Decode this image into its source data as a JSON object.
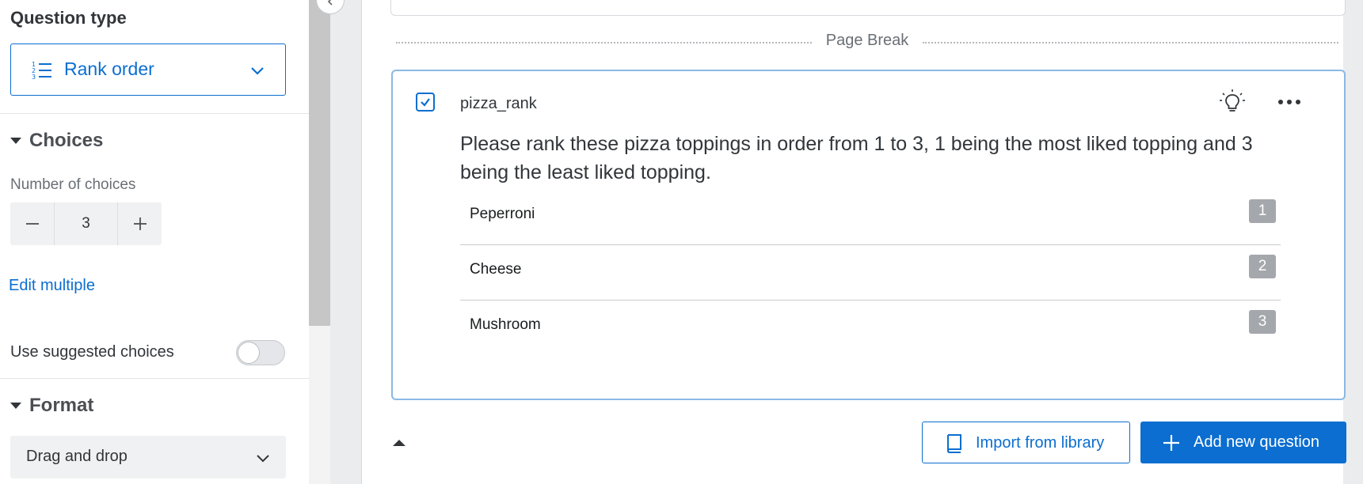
{
  "left_panel": {
    "question_type_heading": "Question type",
    "question_type_value": "Rank order",
    "choices_section": {
      "title": "Choices",
      "number_label": "Number of choices",
      "number_value": "3",
      "edit_multiple": "Edit multiple",
      "suggested_label": "Use suggested choices",
      "suggested_on": false
    },
    "format_section": {
      "title": "Format",
      "format_value": "Drag and drop"
    }
  },
  "main": {
    "page_break_label": "Page Break",
    "question": {
      "id": "pizza_rank",
      "selected": true,
      "text": "Please rank these pizza toppings in order from 1 to 3, 1 being the most liked topping and 3 being the least liked topping.",
      "choices": [
        {
          "label": "Peperroni",
          "rank": "1"
        },
        {
          "label": "Cheese",
          "rank": "2"
        },
        {
          "label": "Mushroom",
          "rank": "3"
        }
      ]
    },
    "import_label": "Import from library",
    "add_label": "Add new question"
  },
  "colors": {
    "accent": "#0b6ed0",
    "selected_border": "#8ab8e6",
    "rank_badge": "#a4a7ab"
  },
  "icons": [
    "list-numbered-icon",
    "chevron-down-icon",
    "caret-down-icon",
    "minus-icon",
    "plus-icon",
    "checkmark-icon",
    "lightbulb-icon",
    "more-horizontal-icon",
    "book-icon",
    "chevron-left-icon",
    "caret-up-icon"
  ]
}
